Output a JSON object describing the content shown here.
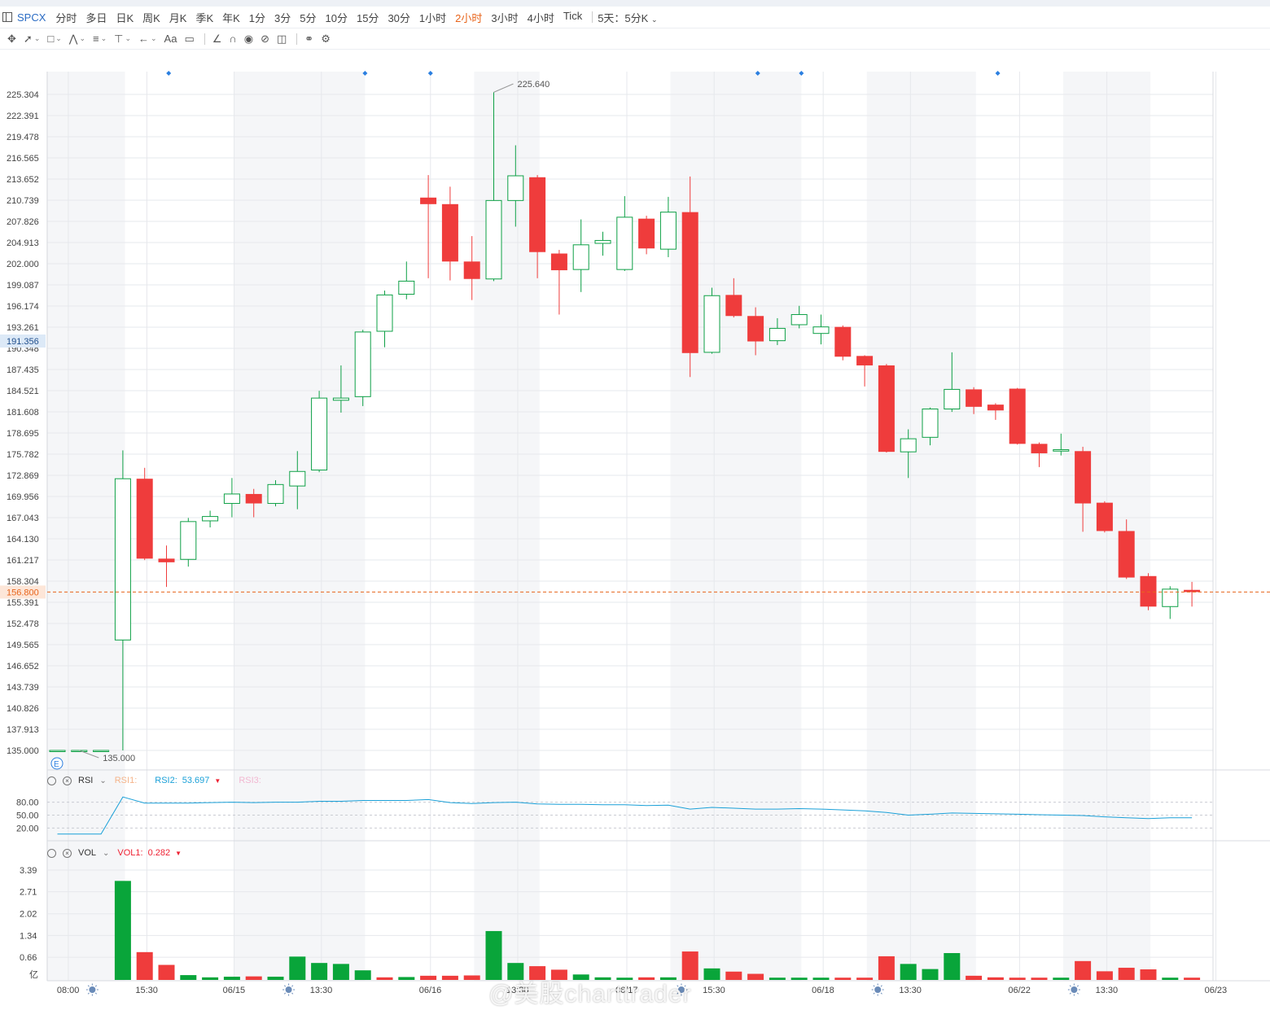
{
  "toolbar": {
    "symbol": "SPCX",
    "timeframes": [
      "分时",
      "多日",
      "日K",
      "周K",
      "月K",
      "季K",
      "年K",
      "1分",
      "3分",
      "5分",
      "10分",
      "15分",
      "30分",
      "1小时",
      "2小时",
      "3小时",
      "4小时",
      "Tick"
    ],
    "active_timeframe": "2小时",
    "more_label": "5天：5分K",
    "accent_color": "#e8641b"
  },
  "drawing_tools": [
    "move-icon",
    "line-icon",
    "rect-icon",
    "pattern-icon",
    "fib-icon",
    "measure-icon",
    "arrow-icon",
    "text-icon",
    "comment-icon",
    "ruler-icon",
    "magnet-icon",
    "eye-icon",
    "hide-icon",
    "trash-icon",
    "link-icon",
    "settings-icon"
  ],
  "watermark": "@美股charttrader",
  "chart_data": {
    "type": "candlestick",
    "y_ticks": [
      "135.000",
      "137.913",
      "140.826",
      "143.739",
      "146.652",
      "149.565",
      "152.478",
      "155.391",
      "158.304",
      "161.217",
      "164.130",
      "167.043",
      "169.956",
      "172.869",
      "175.782",
      "178.695",
      "181.608",
      "184.521",
      "187.435",
      "190.348",
      "193.261",
      "196.174",
      "199.087",
      "202.000",
      "204.913",
      "207.826",
      "210.739",
      "213.652",
      "216.565",
      "219.478",
      "222.391",
      "225.304"
    ],
    "ylim": [
      135.0,
      225.304
    ],
    "current_price": "156.800",
    "crosshair_price": "191.356",
    "high_label": "225.640",
    "low_label": "135.000",
    "event_markers": [
      1,
      2,
      3,
      4,
      5,
      6
    ],
    "candles": [
      {
        "o": 135.0,
        "h": 135.0,
        "l": 135.0,
        "c": 135.0
      },
      {
        "o": 135.0,
        "h": 135.0,
        "l": 135.0,
        "c": 135.0
      },
      {
        "o": 135.0,
        "h": 135.0,
        "l": 135.0,
        "c": 135.0
      },
      {
        "o": 150.2,
        "h": 176.3,
        "l": 135.0,
        "c": 172.4
      },
      {
        "o": 172.4,
        "h": 173.9,
        "l": 161.2,
        "c": 161.4
      },
      {
        "o": 161.4,
        "h": 163.2,
        "l": 157.5,
        "c": 160.9
      },
      {
        "o": 161.3,
        "h": 167.0,
        "l": 160.3,
        "c": 166.5
      },
      {
        "o": 166.6,
        "h": 168.0,
        "l": 165.7,
        "c": 167.2
      },
      {
        "o": 169.0,
        "h": 172.5,
        "l": 167.1,
        "c": 170.3
      },
      {
        "o": 170.3,
        "h": 171.0,
        "l": 167.1,
        "c": 169.0
      },
      {
        "o": 169.0,
        "h": 172.2,
        "l": 168.6,
        "c": 171.6
      },
      {
        "o": 171.4,
        "h": 176.2,
        "l": 168.2,
        "c": 173.4
      },
      {
        "o": 173.6,
        "h": 184.5,
        "l": 173.3,
        "c": 183.5
      },
      {
        "o": 183.2,
        "h": 188.0,
        "l": 181.5,
        "c": 183.5
      },
      {
        "o": 183.7,
        "h": 192.9,
        "l": 182.4,
        "c": 192.6
      },
      {
        "o": 192.7,
        "h": 198.3,
        "l": 190.5,
        "c": 197.7
      },
      {
        "o": 197.8,
        "h": 202.3,
        "l": 197.1,
        "c": 199.6
      },
      {
        "o": 211.1,
        "h": 214.2,
        "l": 200.0,
        "c": 210.2
      },
      {
        "o": 210.2,
        "h": 212.6,
        "l": 199.7,
        "c": 202.3
      },
      {
        "o": 202.3,
        "h": 205.8,
        "l": 197.0,
        "c": 199.9
      },
      {
        "o": 199.9,
        "h": 225.6,
        "l": 199.6,
        "c": 210.7
      },
      {
        "o": 210.7,
        "h": 218.3,
        "l": 207.1,
        "c": 214.1
      },
      {
        "o": 213.9,
        "h": 214.2,
        "l": 200.0,
        "c": 203.6
      },
      {
        "o": 203.4,
        "h": 203.9,
        "l": 195.0,
        "c": 201.1
      },
      {
        "o": 201.2,
        "h": 208.1,
        "l": 198.1,
        "c": 204.6
      },
      {
        "o": 204.8,
        "h": 206.4,
        "l": 203.1,
        "c": 205.2
      },
      {
        "o": 201.2,
        "h": 211.3,
        "l": 201.0,
        "c": 208.4
      },
      {
        "o": 208.2,
        "h": 208.6,
        "l": 203.3,
        "c": 204.1
      },
      {
        "o": 204.0,
        "h": 211.2,
        "l": 202.9,
        "c": 209.1
      },
      {
        "o": 209.1,
        "h": 214.0,
        "l": 186.4,
        "c": 189.7
      },
      {
        "o": 189.8,
        "h": 198.7,
        "l": 189.6,
        "c": 197.6
      },
      {
        "o": 197.7,
        "h": 200.0,
        "l": 194.6,
        "c": 194.8
      },
      {
        "o": 194.8,
        "h": 196.0,
        "l": 189.4,
        "c": 191.3
      },
      {
        "o": 191.4,
        "h": 194.5,
        "l": 190.8,
        "c": 193.1
      },
      {
        "o": 193.6,
        "h": 196.2,
        "l": 193.1,
        "c": 195.0
      },
      {
        "o": 192.4,
        "h": 195.0,
        "l": 190.9,
        "c": 193.3
      },
      {
        "o": 193.3,
        "h": 193.5,
        "l": 188.7,
        "c": 189.2
      },
      {
        "o": 189.3,
        "h": 189.4,
        "l": 185.1,
        "c": 188.0
      },
      {
        "o": 188.0,
        "h": 188.2,
        "l": 176.0,
        "c": 176.1
      },
      {
        "o": 176.1,
        "h": 179.2,
        "l": 172.5,
        "c": 177.9
      },
      {
        "o": 178.1,
        "h": 182.2,
        "l": 177.0,
        "c": 182.0
      },
      {
        "o": 182.0,
        "h": 189.8,
        "l": 181.6,
        "c": 184.7
      },
      {
        "o": 184.7,
        "h": 185.0,
        "l": 181.3,
        "c": 182.3
      },
      {
        "o": 182.6,
        "h": 182.8,
        "l": 180.5,
        "c": 181.8
      },
      {
        "o": 184.8,
        "h": 184.9,
        "l": 177.1,
        "c": 177.2
      },
      {
        "o": 177.2,
        "h": 177.4,
        "l": 174.0,
        "c": 175.9
      },
      {
        "o": 176.2,
        "h": 178.6,
        "l": 175.6,
        "c": 176.4
      },
      {
        "o": 176.2,
        "h": 176.8,
        "l": 165.1,
        "c": 169.0
      },
      {
        "o": 169.1,
        "h": 169.3,
        "l": 165.0,
        "c": 165.2
      },
      {
        "o": 165.2,
        "h": 166.8,
        "l": 158.6,
        "c": 158.8
      },
      {
        "o": 159.0,
        "h": 159.4,
        "l": 154.3,
        "c": 154.8
      },
      {
        "o": 154.8,
        "h": 157.6,
        "l": 153.1,
        "c": 157.2
      },
      {
        "o": 157.1,
        "h": 158.2,
        "l": 154.8,
        "c": 156.8
      }
    ],
    "x_labels": [
      {
        "label": "08:00",
        "i": 0.5
      },
      {
        "label": "15:30",
        "i": 4.1
      },
      {
        "label": "06/15",
        "i": 8.1
      },
      {
        "label": "13:30",
        "i": 12.1
      },
      {
        "label": "06/16",
        "i": 17.1
      },
      {
        "label": "13:30",
        "i": 21.1
      },
      {
        "label": "06/17",
        "i": 26.1
      },
      {
        "label": "15:30",
        "i": 30.1
      },
      {
        "label": "06/18",
        "i": 35.1
      },
      {
        "label": "13:30",
        "i": 39.1
      },
      {
        "label": "06/22",
        "i": 44.1
      },
      {
        "label": "13:30",
        "i": 48.1
      },
      {
        "label": "06/23",
        "i": 53.1
      }
    ],
    "day_icons": [
      1.6,
      10.6,
      28.6,
      37.6,
      46.6
    ],
    "rsi": {
      "label": "RSI",
      "rsi1_label": "RSI1:",
      "rsi2_label": "RSI2:",
      "rsi2_value": "53.697",
      "rsi3_label": "RSI3:",
      "levels": [
        "80.00",
        "50.00",
        "20.00"
      ],
      "ylim": [
        0,
        100
      ],
      "values": [
        6,
        6,
        6,
        92,
        78,
        78,
        78,
        79,
        80,
        79,
        80,
        80,
        82,
        82,
        84,
        84,
        84,
        86,
        79,
        77,
        79,
        80,
        76,
        75,
        75,
        74,
        74,
        72,
        73,
        64,
        68,
        66,
        64,
        64,
        65,
        64,
        62,
        60,
        56,
        50,
        52,
        55,
        54,
        53,
        52,
        51,
        50,
        49,
        46,
        44,
        42,
        44,
        44
      ]
    },
    "vol": {
      "label": "VOL",
      "vol1_label": "VOL1:",
      "vol1_value": "0.282",
      "y_ticks": [
        "0.66",
        "1.34",
        "2.02",
        "2.71",
        "3.39"
      ],
      "unit_label": "亿",
      "ylim": [
        0,
        3.39
      ],
      "values": [
        0,
        0,
        0,
        3.05,
        0.82,
        0.42,
        0.1,
        0.03,
        0.05,
        0.06,
        0.05,
        0.68,
        0.48,
        0.45,
        0.25,
        0.03,
        0.04,
        0.08,
        0.08,
        0.09,
        1.48,
        0.48,
        0.38,
        0.27,
        0.12,
        0.03,
        0.02,
        0.03,
        0.03,
        0.84,
        0.31,
        0.21,
        0.14,
        0.02,
        0.02,
        0.02,
        0.02,
        0.02,
        0.69,
        0.45,
        0.29,
        0.79,
        0.08,
        0.03,
        0.02,
        0.02,
        0.02,
        0.54,
        0.22,
        0.33,
        0.28,
        0.02,
        0.02
      ],
      "up": [
        0,
        0,
        0,
        1,
        0,
        0,
        1,
        1,
        1,
        0,
        1,
        1,
        1,
        1,
        1,
        0,
        1,
        0,
        0,
        0,
        1,
        1,
        0,
        0,
        1,
        1,
        1,
        0,
        1,
        0,
        1,
        0,
        0,
        1,
        1,
        1,
        0,
        0,
        0,
        1,
        1,
        1,
        0,
        0,
        0,
        0,
        1,
        0,
        0,
        0,
        0,
        1,
        0
      ]
    },
    "colors": {
      "up": "#0ea046",
      "down": "#ef3c3c",
      "grid": "#e6e8ec",
      "axis": "#555555",
      "price_line": "#e8641b",
      "rsi_line": "#1aa0d8",
      "marker": "#2b7fe0",
      "vol_up": "#09a53a"
    }
  }
}
